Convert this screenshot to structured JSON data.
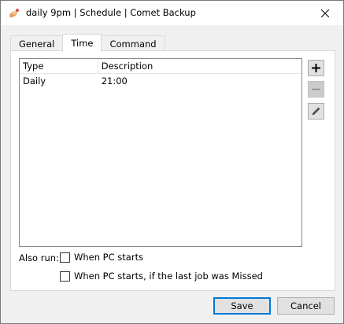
{
  "window": {
    "title": "daily 9pm | Schedule | Comet Backup",
    "app_icon": "comet-icon",
    "close_icon": "close-icon"
  },
  "tabs": [
    {
      "label": "General",
      "active": false
    },
    {
      "label": "Time",
      "active": true
    },
    {
      "label": "Command",
      "active": false
    }
  ],
  "schedule_table": {
    "columns": [
      "Type",
      "Description"
    ],
    "rows": [
      {
        "type": "Daily",
        "description": "21:00"
      }
    ]
  },
  "side_buttons": [
    {
      "name": "add-button",
      "icon": "plus-icon",
      "enabled": true
    },
    {
      "name": "remove-button",
      "icon": "minus-icon",
      "enabled": false
    },
    {
      "name": "edit-button",
      "icon": "pencil-icon",
      "enabled": true
    }
  ],
  "also_run": {
    "label": "Also run:",
    "options": [
      {
        "label": "When PC starts",
        "checked": false
      },
      {
        "label": "When PC starts, if the last job was Missed",
        "checked": false
      }
    ]
  },
  "buttons": {
    "save": "Save",
    "cancel": "Cancel"
  }
}
